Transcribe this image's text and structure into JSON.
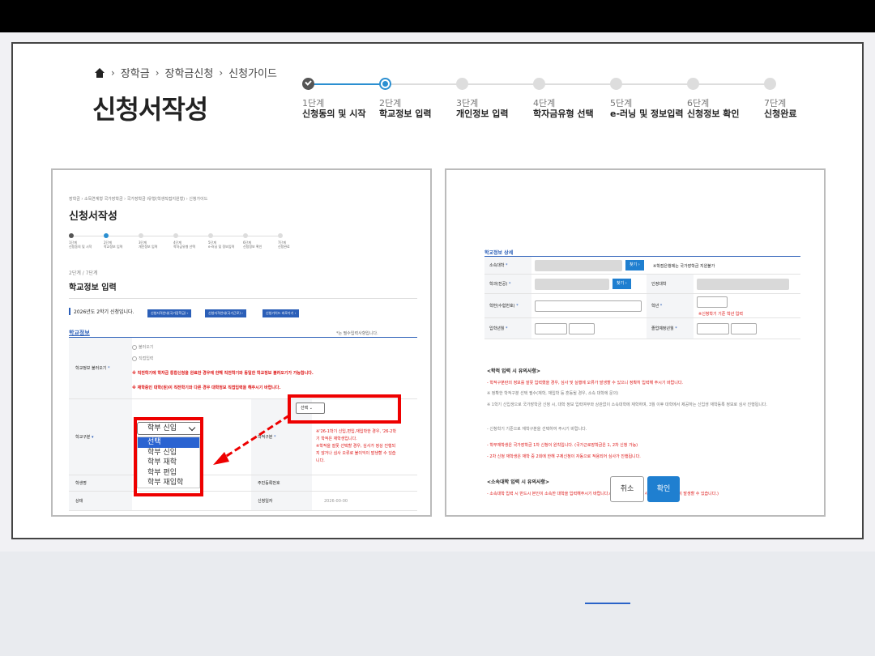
{
  "header": {
    "breadcrumb": [
      "장학금",
      "장학금신청",
      "신청가이드"
    ],
    "title": "신청서작성",
    "steps": [
      {
        "num": "1단계",
        "label": "신청동의 및 시작",
        "state": "done"
      },
      {
        "num": "2단계",
        "label": "학교정보 입력",
        "state": "current"
      },
      {
        "num": "3단계",
        "label": "개인정보 입력",
        "state": "todo"
      },
      {
        "num": "4단계",
        "label": "학자금유형 선택",
        "state": "todo"
      },
      {
        "num": "5단계",
        "label": "e-러닝 및 정보입력",
        "state": "todo"
      },
      {
        "num": "6단계",
        "label": "신청정보 확인",
        "state": "todo"
      },
      {
        "num": "7단계",
        "label": "신청완료",
        "state": "todo"
      }
    ]
  },
  "left_panel": {
    "breadcrumb": "장학금 › 소득연계형 국가장학금 › 국가장학금 I유형(학생직접지원형) › 신청가이드",
    "title": "신청서작성",
    "mini_steps": [
      "1단계\n신청동의 및 시작",
      "2단계\n학교정보 입력",
      "3단계\n개인정보 입력",
      "4단계\n학자금유형 선택",
      "5단계\ne-러닝 및 정보입력",
      "6단계\n신청정보 확인",
      "7단계\n신청완료"
    ],
    "stage": "2단계 / 7단계",
    "section_title": "학교정보 입력",
    "term": "2026년도 2학기 신청입니다.",
    "term_year": "2026",
    "buttons": [
      "신청자격안내(국가장학금) ›",
      "신청자격안내(국가근로) ›",
      "신청가이드 바로가기 ›"
    ],
    "info_title": "학교정보",
    "required_note": "*는 필수입력사항입니다.",
    "load_label": "학교정보 불러오기",
    "radio1": "불러오기",
    "radio2": "직접입력",
    "red1": "※ 직전학기에 학자금 통합신청을 완료한 경우에 한해 직전학기와 동일한 학교정보 불러오기가 가능합니다.",
    "red2": "※ 재학중인 대학(원)이 직전학기와 다른 경우 대학정보 직접입력을 해주시기 바랍니다.",
    "school_type_label": "학교구분",
    "school_type_value": "학부 신입",
    "options": [
      "선택",
      "학부 신입",
      "학부 재학",
      "학부 편입",
      "학부 재입학"
    ],
    "right_label": "학적구분",
    "right_select": "선택",
    "red_note": "※'26-1학기 신입,편입,재입학한 경우, '26-2학기 학적은 재학생입니다.\n※학적을 잘못 선택할 경우, 심사가 정상 진행되지 않거나 심사 오류로 불이익이 발생할 수 있습니다.",
    "row_student_name": "학생명",
    "row_resident": "주민등록번호",
    "row_status": "상태",
    "row_date": "신청일자",
    "date_value": "2026-00-00"
  },
  "right_panel": {
    "detail_title": "학교정보 상세",
    "rows": {
      "school": "소속대학",
      "find": "찾기 ›",
      "school_note": "※학점은행제는 국가장학금 지원불가",
      "dept": "학과(전공)",
      "recognized": "인정대학",
      "student_id": "학번(수험번호)",
      "grade": "학년",
      "grade_note": "※신청학기 기준 학년 입력",
      "entrance": "입학년월",
      "graduate": "졸업예정년월"
    },
    "notice1_title": "<학적 입력 시 유의사항>",
    "notice1_lines": [
      "- 학적구분란의 정보를 잘못 입력했을 경우, 심사 및 실행에 오류가 발생할 수 있으니 정확히 입력해 주시기 바랍니다.",
      "※ 정확한 학적구분 선택 필수(재학, 재입학 등 혼동될 경우, 소속 대학에 문의)",
      "※ 1학기 신입생으로 국가장학금 신청 시, 대학 정보 입력여부와 상관없이 소속대학에 재학하며, 3월 이후 대학에서 제공하는 신입생 재학등록 정보로 심사 진행됩니다.",
      "- 신청학기 기준으로 재학구분을 선택하여 주시기 바랍니다.",
      "- 학부재학생은 국가장학금 1차 신청이 원칙입니다. (국가근로장학금은 1, 2차 신청 가능)",
      "- 2차 신청 재학생은 재학 중 2회에 한해 구제신청이 자동으로 적용되어 심사가 진행됩니다."
    ],
    "notice2_title": "<소속대학 입력 시 유의사항>",
    "notice2_line": "- 소속대학 입력 시 반드시 본인이 소속한 대학을 입력해주시기 바랍니다.(오신청 시 장학금 심사 및 지급에 불이익이 발생할 수 있습니다.)",
    "cancel": "취소",
    "confirm": "확인"
  }
}
